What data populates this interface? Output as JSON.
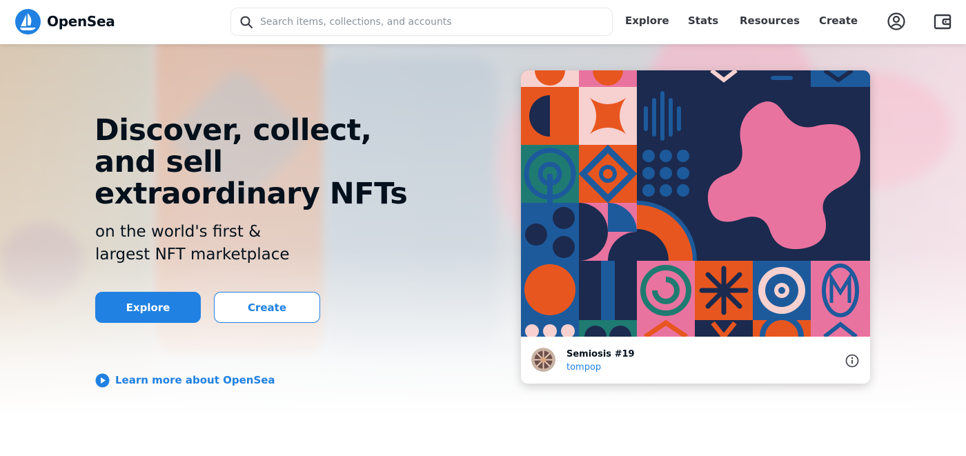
{
  "header": {
    "brand_name": "OpenSea",
    "logo_icon": "opensea-sailboat-logo",
    "search": {
      "placeholder": "Search items, collections, and accounts",
      "value": "",
      "icon": "search-icon"
    },
    "nav": [
      {
        "label": "Explore"
      },
      {
        "label": "Stats"
      },
      {
        "label": "Resources"
      },
      {
        "label": "Create"
      }
    ],
    "icons": [
      "account-icon",
      "wallet-icon"
    ]
  },
  "hero": {
    "title": "Discover, collect, and sell extraordinary NFTs",
    "subtitle": "on the world's first & largest NFT marketplace",
    "primary_button": "Explore",
    "secondary_button": "Create",
    "learn_more": "Learn more about OpenSea",
    "learn_more_icon": "play-circle-icon"
  },
  "featured": {
    "name": "Semiosis #19",
    "creator": "tompop",
    "info_icon": "info-icon"
  },
  "colors": {
    "accent": "#2081e2",
    "text": "#04111d",
    "art_navy": "#1b2a4e",
    "art_orange": "#e8561f",
    "art_pink": "#e9739f",
    "art_teal": "#1f7b72",
    "art_blue": "#1d5a9c",
    "art_blush": "#f7d1cf"
  }
}
